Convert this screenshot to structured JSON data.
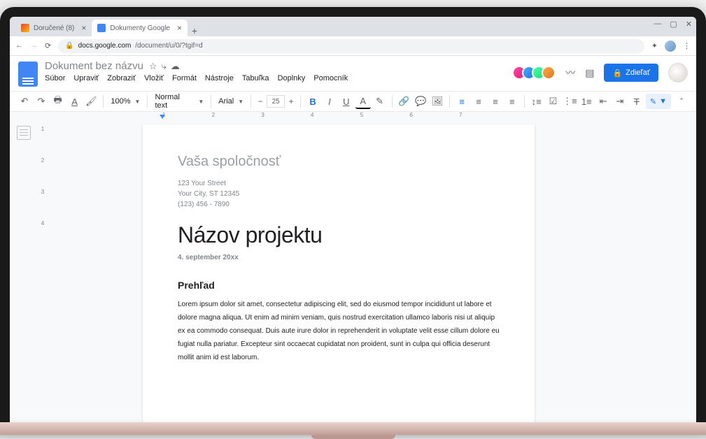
{
  "browser": {
    "tabs": [
      {
        "label": "Doručené (8)",
        "active": false
      },
      {
        "label": "Dokumenty Google",
        "active": true
      }
    ],
    "url_host": "docs.google.com",
    "url_path": "/document/u/0/?tgif=d"
  },
  "docs": {
    "title": "Dokument bez názvu",
    "menu": [
      "Súbor",
      "Upraviť",
      "Zobraziť",
      "Vložiť",
      "Formát",
      "Nástroje",
      "Tabuľka",
      "Doplnky",
      "Pomocník"
    ],
    "share_label": "Zdieľať"
  },
  "toolbar": {
    "zoom": "100%",
    "style": "Normal text",
    "font": "Arial",
    "font_size": "25"
  },
  "ruler_h": "1 2 3 4 5 6 7",
  "ruler_v": [
    "1",
    "2",
    "3",
    "4"
  ],
  "document": {
    "company": "Vaša spoločnosť",
    "addr1": "123 Your Street",
    "addr2": "Your City, ST 12345",
    "addr3": "(123) 456 - 7890",
    "project_title": "Názov projektu",
    "date": "4. september 20xx",
    "section": "Prehľad",
    "body": "Lorem ipsum dolor sit amet, consectetur adipiscing elit, sed do eiusmod tempor incididunt ut labore et dolore magna aliqua. Ut enim ad minim veniam, quis nostrud exercitation ullamco laboris nisi ut aliquip ex ea commodo consequat. Duis aute irure dolor in reprehenderit in voluptate velit esse cillum dolore eu fugiat nulla pariatur. Excepteur sint occaecat cupidatat non proident, sunt in culpa qui officia deserunt mollit anim id est laborum."
  }
}
